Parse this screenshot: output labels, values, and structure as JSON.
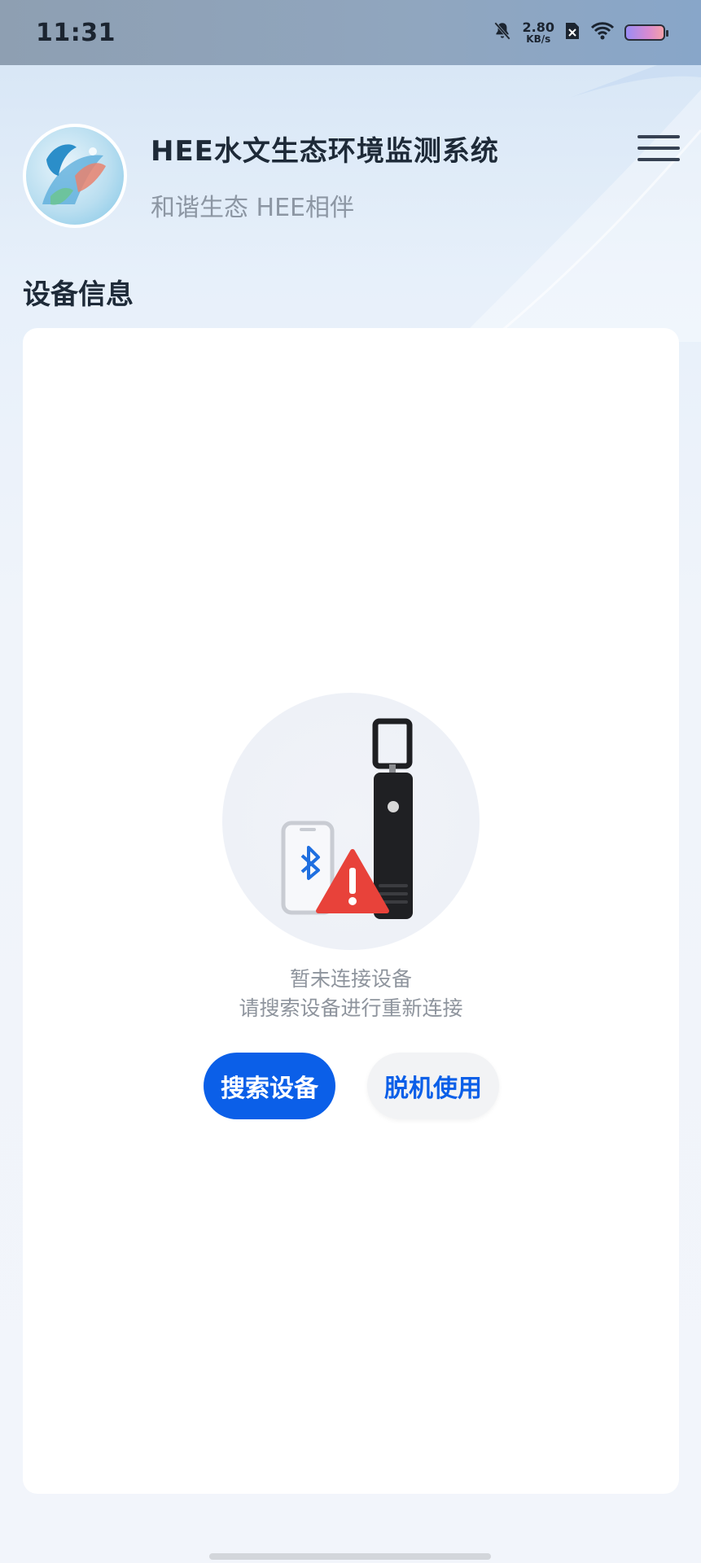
{
  "status_bar": {
    "time": "11:31",
    "net_speed_value": "2.80",
    "net_speed_unit": "KB/s",
    "icons": [
      "bell-muted-icon",
      "sim-x-icon",
      "wifi-icon",
      "battery-icon"
    ]
  },
  "header": {
    "title": "HEE水文生态环境监测系统",
    "subtitle": "和谐生态 HEE相伴",
    "menu_icon": "hamburger-menu-icon"
  },
  "section": {
    "title": "设备信息"
  },
  "device_card": {
    "empty_line1": "暂未连接设备",
    "empty_line2": "请搜索设备进行重新连接",
    "search_button": "搜索设备",
    "offline_button": "脱机使用"
  },
  "colors": {
    "accent": "#0b5fe8",
    "warning": "#e8423a",
    "bluetooth": "#1f6fe0"
  }
}
